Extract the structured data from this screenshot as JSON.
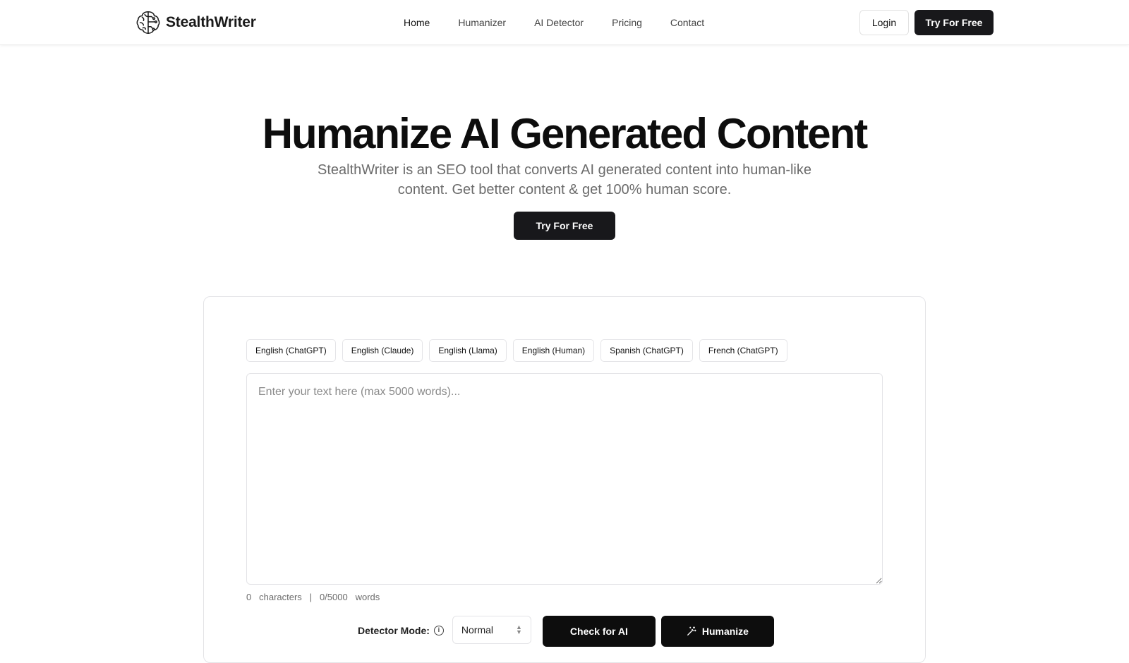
{
  "header": {
    "brand": "StealthWriter",
    "nav": [
      {
        "label": "Home",
        "active": true
      },
      {
        "label": "Humanizer",
        "active": false
      },
      {
        "label": "AI Detector",
        "active": false
      },
      {
        "label": "Pricing",
        "active": false
      },
      {
        "label": "Contact",
        "active": false
      }
    ],
    "login_label": "Login",
    "try_label": "Try For Free",
    "logo_icon": "brain-circuit-icon"
  },
  "hero": {
    "title": "Humanize AI Generated Content",
    "subtitle": "StealthWriter is an SEO tool that converts AI generated content into human-like content. Get better content & get 100% human score.",
    "cta_label": "Try For Free"
  },
  "tool": {
    "samples": [
      "English (ChatGPT)",
      "English (Claude)",
      "English (Llama)",
      "English (Human)",
      "Spanish (ChatGPT)",
      "French (ChatGPT)"
    ],
    "input_placeholder": "Enter your text here (max 5000 words)...",
    "input_value": "",
    "counter": {
      "characters": "0",
      "characters_label": "characters",
      "separator": "|",
      "words": "0/5000",
      "words_label": "words"
    },
    "detector_label": "Detector Mode:",
    "detector_value": "Normal",
    "check_label": "Check for AI",
    "humanize_label": "Humanize"
  },
  "colors": {
    "primary_button": "#18181b",
    "border": "#e4e4e7",
    "muted_text": "#6b6b6b"
  }
}
